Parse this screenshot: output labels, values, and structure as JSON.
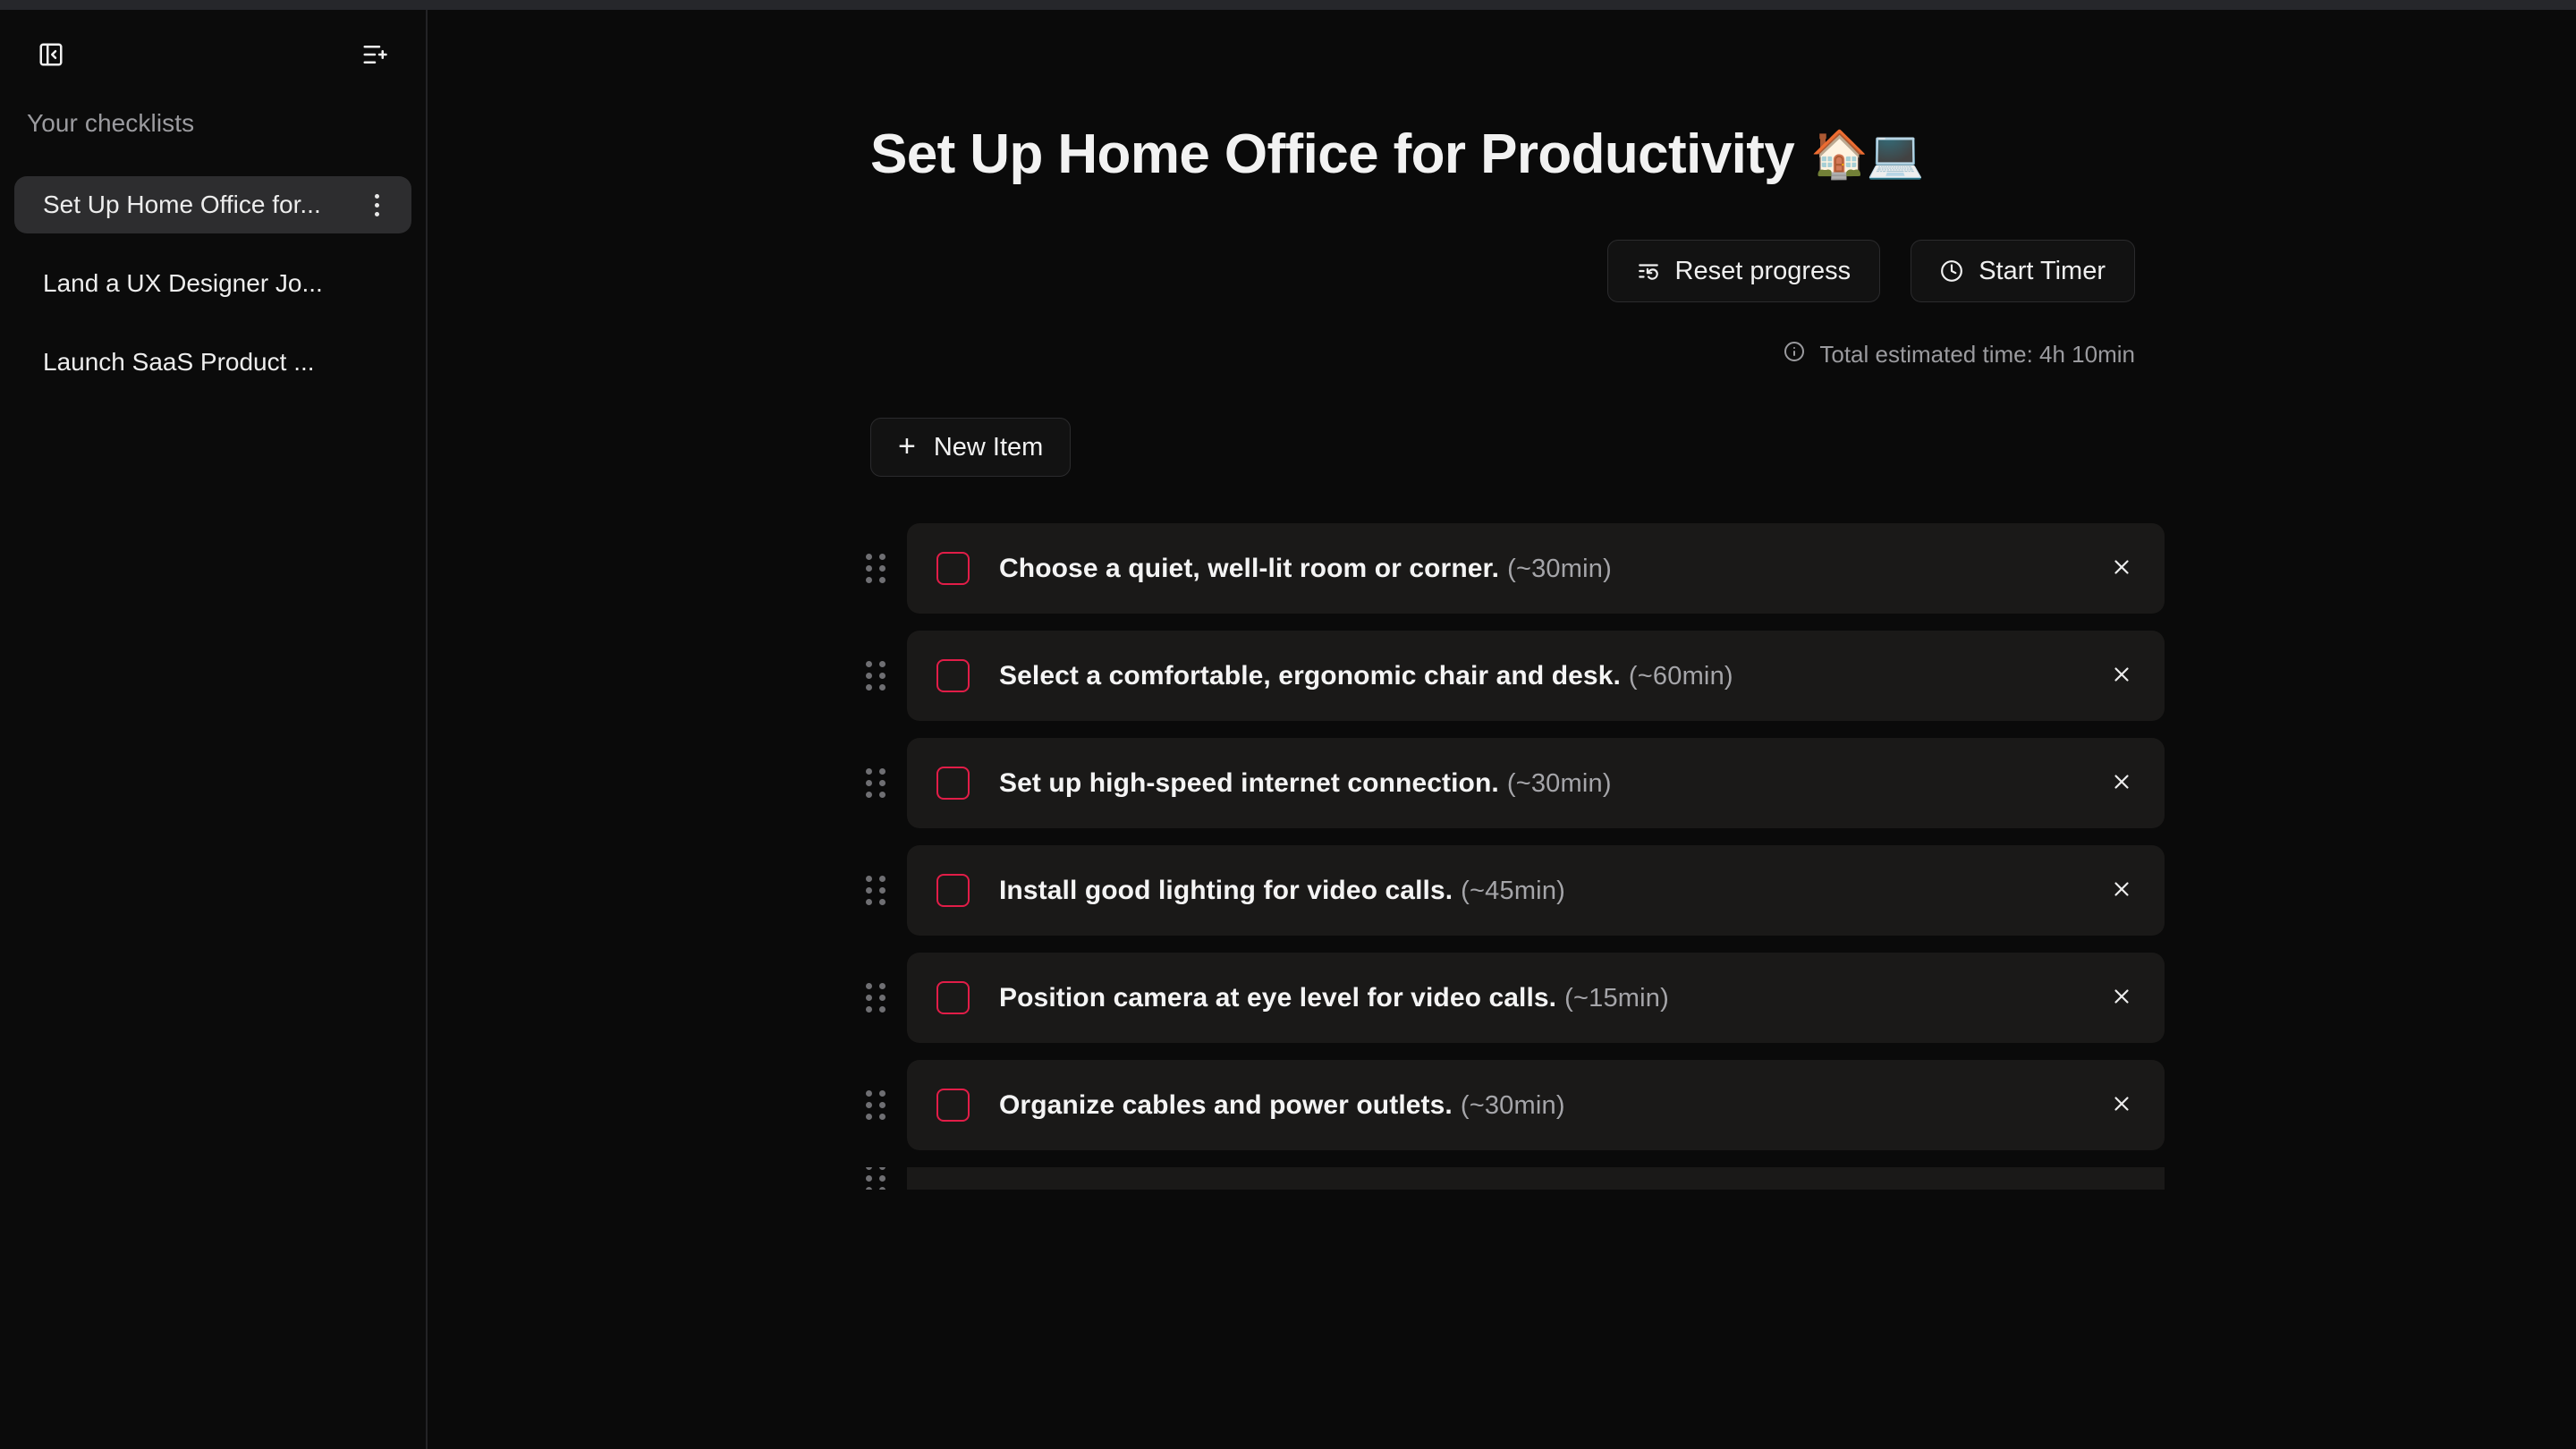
{
  "window": {
    "titlebar_color": "#26272b"
  },
  "sidebar": {
    "collapse_icon": "panel-left-close-icon",
    "new_list_icon": "list-plus-icon",
    "heading": "Your checklists",
    "items": [
      {
        "label": "Set Up Home Office for...",
        "active": true,
        "menu_icon": "kebab-menu-icon"
      },
      {
        "label": "Land a UX Designer Jo...",
        "active": false
      },
      {
        "label": "Launch SaaS Product ...",
        "active": false
      }
    ]
  },
  "main": {
    "title": "Set Up Home Office for Productivity",
    "title_emoji": "🏠💻",
    "actions": {
      "reset_label": "Reset progress",
      "reset_icon": "list-restart-icon",
      "timer_label": "Start Timer",
      "timer_icon": "clock-icon"
    },
    "estimate": {
      "icon": "info-circle-icon",
      "text": "Total estimated time: 4h 10min"
    },
    "new_item": {
      "label": "New Item",
      "icon": "plus-icon"
    },
    "accent_color": "#e21d48",
    "tasks": [
      {
        "text": "Choose a quiet, well-lit room or corner.",
        "estimate": "(~30min)",
        "checked": false
      },
      {
        "text": "Select a comfortable, ergonomic chair and desk.",
        "estimate": "(~60min)",
        "checked": false
      },
      {
        "text": "Set up high-speed internet connection.",
        "estimate": "(~30min)",
        "checked": false
      },
      {
        "text": "Install good lighting for video calls.",
        "estimate": "(~45min)",
        "checked": false
      },
      {
        "text": "Position camera at eye level for video calls.",
        "estimate": "(~15min)",
        "checked": false
      },
      {
        "text": "Organize cables and power outlets.",
        "estimate": "(~30min)",
        "checked": false
      }
    ],
    "delete_icon": "close-x-icon",
    "drag_icon": "grip-vertical-icon"
  }
}
